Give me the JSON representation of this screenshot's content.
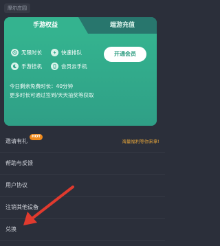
{
  "header": {
    "game_title": "摩尔庄园"
  },
  "vip_card": {
    "tabs": [
      {
        "label": "手游权益",
        "active": true
      },
      {
        "label": "端游充值",
        "active": false
      }
    ],
    "benefits": [
      {
        "label": "无限时长",
        "icon": "clock-icon"
      },
      {
        "label": "快速排队",
        "icon": "lightning-icon"
      },
      {
        "label": "手游挂机",
        "icon": "moon-icon"
      },
      {
        "label": "会员云手机",
        "icon": "phone-icon"
      }
    ],
    "cta_label": "开通会员",
    "free_time": "今日剩余免费时长：40分钟",
    "more_time": "更多时长可通过签到/天天抽奖等获取"
  },
  "menu": {
    "items": [
      {
        "label": "邀请有礼",
        "badge": "HOT",
        "promo": "海量福利等你来拿!"
      },
      {
        "label": "帮助与反馈"
      },
      {
        "label": "用户协议"
      },
      {
        "label": "注销其他设备"
      },
      {
        "label": "兑换"
      }
    ]
  },
  "colors": {
    "background": "#2b2f3a",
    "card_green": "#34b38f",
    "arrow_red": "#e03a2e",
    "hot_badge": "#f08a1c",
    "promo_text": "#e0a23a"
  }
}
